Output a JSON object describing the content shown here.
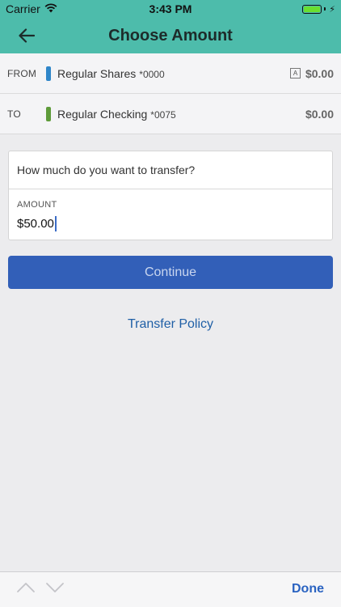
{
  "status_bar": {
    "carrier": "Carrier",
    "time": "3:43 PM",
    "battery_color": "#6adf2f"
  },
  "nav": {
    "title": "Choose Amount",
    "back_icon": "back-arrow-icon"
  },
  "accounts": {
    "from": {
      "label": "FROM",
      "name": "Regular Shares",
      "number": "*0000",
      "badge": "A",
      "balance": "$0.00",
      "color": "#2f86c9"
    },
    "to": {
      "label": "TO",
      "name": "Regular Checking",
      "number": "*0075",
      "balance": "$0.00",
      "color": "#5e9b3a"
    }
  },
  "amount_card": {
    "question": "How much do you want to transfer?",
    "amount_label": "AMOUNT",
    "amount_value": "$50.00"
  },
  "continue_label": "Continue",
  "policy_label": "Transfer Policy",
  "accessory": {
    "done_label": "Done"
  },
  "colors": {
    "header": "#4dbcab",
    "primary_button": "#325fb8",
    "link": "#1f5fa6"
  }
}
